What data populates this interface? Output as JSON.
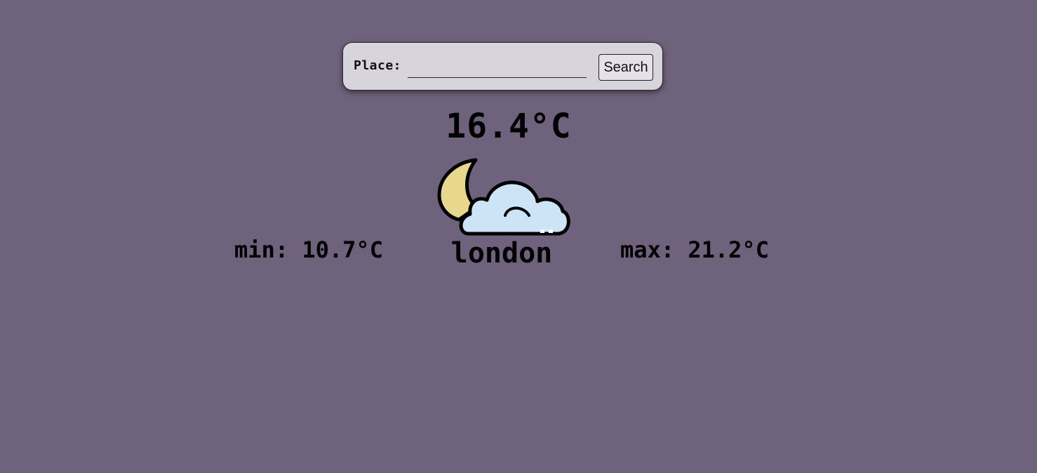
{
  "search": {
    "label": "Place:",
    "input_value": "",
    "button_label": "Search"
  },
  "weather": {
    "temperature": "16.4°C",
    "min": "min: 10.7°C",
    "max": "max: 21.2°C",
    "city": "london",
    "icon": "moon-cloud-icon"
  },
  "colors": {
    "background": "#6f627c",
    "card": "#d8d4db",
    "moon": "#e8d88e",
    "cloud": "#cde3f6"
  }
}
